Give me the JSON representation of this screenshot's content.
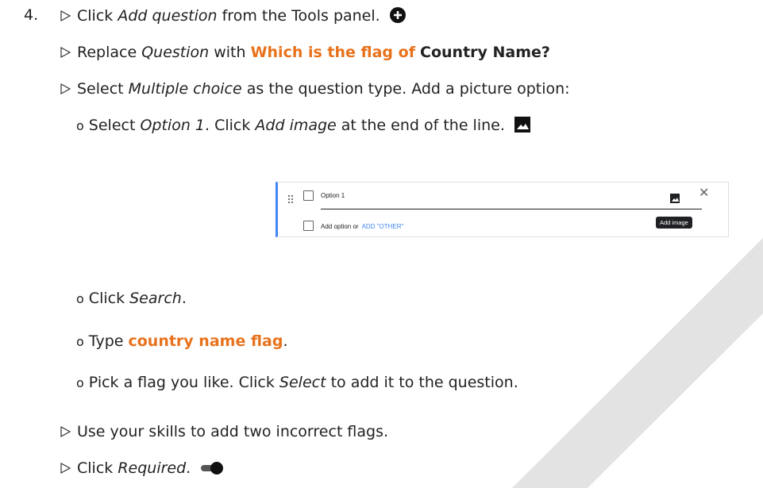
{
  "step": {
    "number": "4."
  },
  "lines": {
    "l1": {
      "pre": "Click ",
      "em": "Add question",
      "post": " from the Tools panel."
    },
    "l2": {
      "pre": "Replace ",
      "em": "Question",
      "mid": " with ",
      "orange": "Which is the flag of",
      "bold": "Country Name?"
    },
    "l3": {
      "pre": "Select ",
      "em": "Multiple choice",
      "post": " as the question type. Add a picture option:"
    },
    "l4": {
      "bullet": "o",
      "pre": "Select ",
      "em1": "Option 1",
      "mid": ". Click ",
      "em2": "Add image",
      "post": " at the end of the line."
    },
    "l5": {
      "bullet": "o",
      "pre": "Click ",
      "em": "Search",
      "post": "."
    },
    "l6": {
      "bullet": "o",
      "pre": "Type ",
      "orange": "country name flag",
      "post": "."
    },
    "l7": {
      "bullet": "o",
      "pre": "Pick a flag you like. Click ",
      "em": "Select",
      "post": " to add it to the question."
    },
    "l8": {
      "text": "Use your skills to add two incorrect flags."
    },
    "l9": {
      "pre": "Click ",
      "em": "Required",
      "post": "."
    }
  },
  "snippet": {
    "option_label": "Option 1",
    "add_option": "Add option or",
    "add_other": "ADD \"OTHER\"",
    "tooltip": "Add image",
    "close_glyph": "✕"
  },
  "colors": {
    "accent_orange": "#E8721C",
    "form_blue": "#4285f4",
    "watermark": "#d9d9d9"
  },
  "icons": [
    "triangle-bullet-icon",
    "add-circle-icon",
    "image-icon",
    "drag-handle-icon",
    "close-icon",
    "toggle-icon"
  ]
}
